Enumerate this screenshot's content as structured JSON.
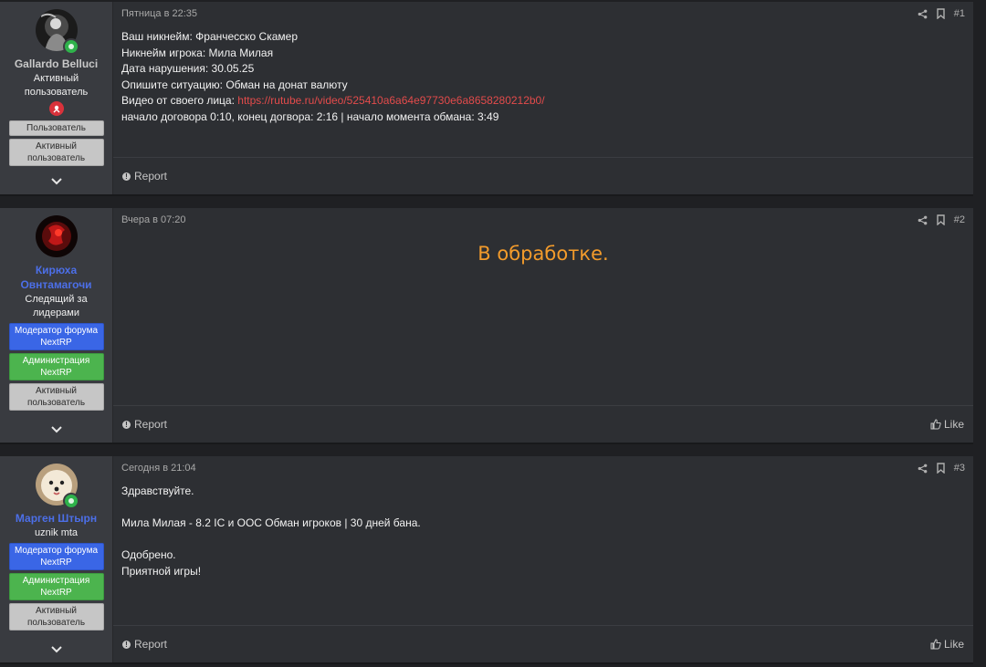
{
  "colors": {
    "page_bg": "#1f2023",
    "post_bg": "#2d2f33",
    "user_panel_bg": "#393b40",
    "link": "#e34b4b",
    "status_orange": "#f39b2b",
    "moderator_banner": "#3a66e6",
    "admin_banner": "#4cb44e",
    "member_banner": "#c6c6c6",
    "online_green": "#2fb24b"
  },
  "posts": [
    {
      "user": {
        "name": "Gallardo Belluci",
        "title_line1": "Активный",
        "title_line2": "пользователь",
        "banners": [
          "Пользователь",
          "Активный пользователь"
        ]
      },
      "date": "Пятница в 22:35",
      "number": "#1",
      "lines": [
        "Ваш никнейм: Франчесско Скамер",
        "Никнейм игрока: Мила Милая",
        "Дата нарушения: 30.05.25",
        "Опишите ситуацию: Обман на донат валюту"
      ],
      "video_label": "Видео от своего лица: ",
      "video_link": "https://rutube.ru/video/525410a6a64e97730e6a8658280212b0/",
      "timing_line": "начало договора 0:10, конец догвора: 2:16 | начало момента обмана: 3:49",
      "report": "Report"
    },
    {
      "user": {
        "name": "Кирюха Овнтамагочи",
        "title": "Следящий за лидерами",
        "banners": [
          "Модератор форума NextRP",
          "Администрация NextRP",
          "Активный пользователь"
        ]
      },
      "date": "Вчера в 07:20",
      "number": "#2",
      "status": "В обработке.",
      "report": "Report",
      "like": "Like"
    },
    {
      "user": {
        "name": "Марген Штырн",
        "title": "uznik mta",
        "banners": [
          "Модератор форума NextRP",
          "Администрация NextRP",
          "Активный пользователь"
        ]
      },
      "date": "Сегодня в 21:04",
      "number": "#3",
      "greeting": "Здравствуйте.",
      "verdict": "Мила Милая - 8.2 IC и OOC Обман игроков | 30 дней бана.",
      "approved": "Одобрено.",
      "closing": "Приятной игры!",
      "report": "Report",
      "like": "Like"
    }
  ],
  "icons": {
    "share": "share-icon",
    "bookmark": "bookmark-icon",
    "report": "info-icon",
    "like": "thumbs-up-icon",
    "expand": "chevron-down-icon",
    "online": "online-status-icon",
    "trophy": "trophy-badge-icon"
  }
}
